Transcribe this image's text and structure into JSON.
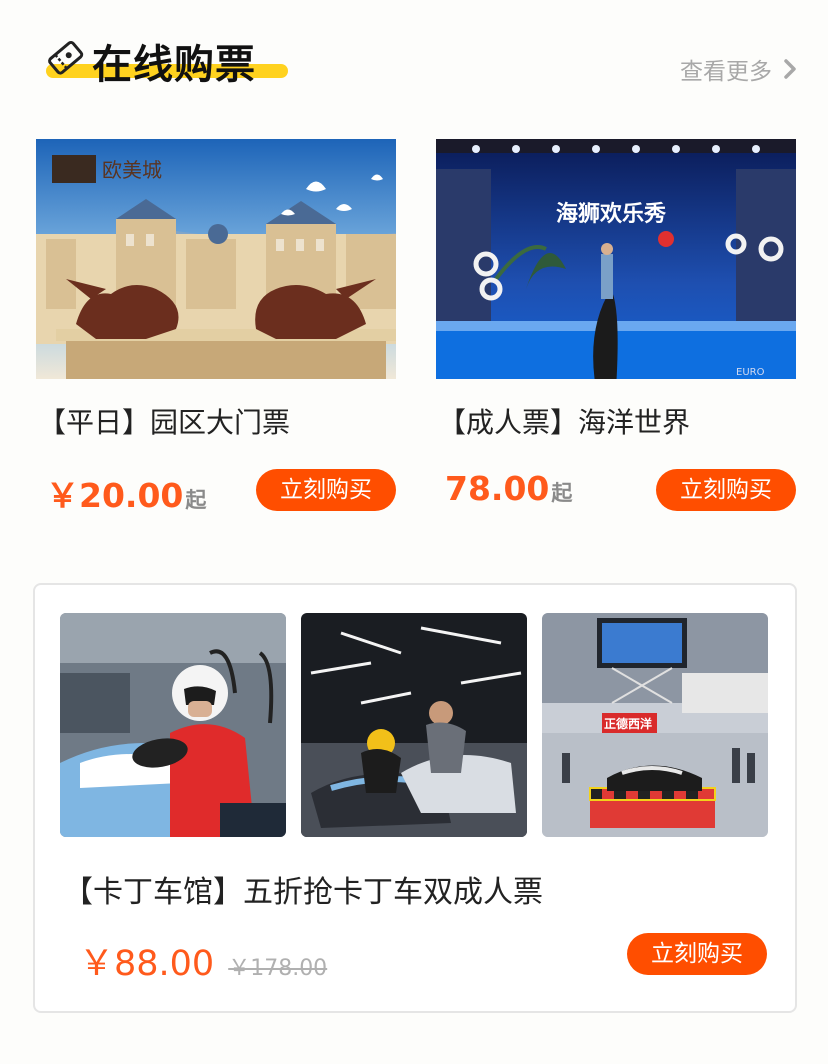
{
  "header": {
    "title": "在线购票",
    "more_label": "查看更多",
    "accent_color": "#ffd21f",
    "icons": [
      "ticket-icon",
      "chevron-right-icon"
    ]
  },
  "products": [
    {
      "name": "【平日】园区大门票",
      "price": "￥20.00",
      "price_suffix": "起",
      "buy_label": "立刻购买",
      "image": {
        "logo_text": "欧美城",
        "scene": "palace-lion-statues"
      }
    },
    {
      "name": "【成人票】海洋世界",
      "price": "78.00",
      "price_suffix": "起",
      "buy_label": "立刻购买",
      "image": {
        "sign_text": "海狮欢乐秀",
        "corner_text": "EURO",
        "scene": "sea-lion-show"
      }
    }
  ],
  "combo": {
    "name": "【卡丁车馆】五折抢卡丁车双成人票",
    "price": "￥88.00",
    "original_price": "￥178.00",
    "buy_label": "立刻购买",
    "images": [
      {
        "scene": "kart-driver-helmet"
      },
      {
        "scene": "kart-track-indoor"
      },
      {
        "scene": "kart-hall-showcase",
        "sign_text": "正德西洋"
      }
    ]
  },
  "colors": {
    "price": "#ff5a1c",
    "button": "#ff4e00"
  }
}
